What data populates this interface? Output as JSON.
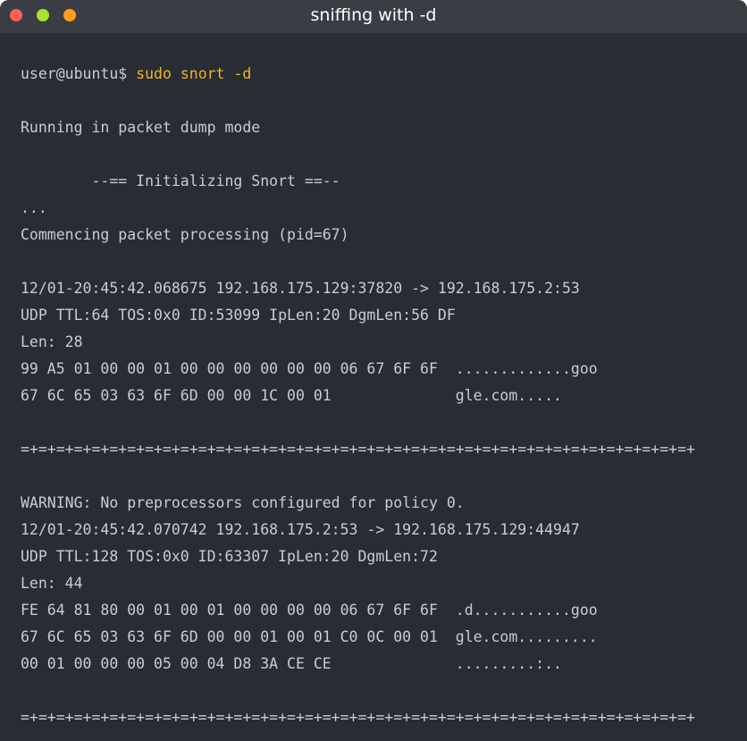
{
  "window": {
    "title": "sniffing with -d",
    "controls": {
      "close_color": "#ff5f57",
      "minimize_color": "#a6e22e",
      "maximize_color": "#ff9f1c"
    }
  },
  "terminal": {
    "prompt": "user@ubuntu$",
    "command": " sudo snort -d",
    "lines": [
      "",
      "Running in packet dump mode",
      "",
      "        --== Initializing Snort ==--",
      "...",
      "Commencing packet processing (pid=67)",
      "",
      "12/01-20:45:42.068675 192.168.175.129:37820 -> 192.168.175.2:53",
      "UDP TTL:64 TOS:0x0 ID:53099 IpLen:20 DgmLen:56 DF",
      "Len: 28",
      "99 A5 01 00 00 01 00 00 00 00 00 00 06 67 6F 6F  .............goo",
      "67 6C 65 03 63 6F 6D 00 00 1C 00 01              gle.com.....",
      "",
      "=+=+=+=+=+=+=+=+=+=+=+=+=+=+=+=+=+=+=+=+=+=+=+=+=+=+=+=+=+=+=+=+=+=+=+=+=+=+",
      "",
      "WARNING: No preprocessors configured for policy 0.",
      "12/01-20:45:42.070742 192.168.175.2:53 -> 192.168.175.129:44947",
      "UDP TTL:128 TOS:0x0 ID:63307 IpLen:20 DgmLen:72",
      "Len: 44",
      "FE 64 81 80 00 01 00 01 00 00 00 00 06 67 6F 6F  .d...........goo",
      "67 6C 65 03 63 6F 6D 00 00 01 00 01 C0 0C 00 01  gle.com.........",
      "00 01 00 00 00 05 00 04 D8 3A CE CE              .........:..",
      "",
      "=+=+=+=+=+=+=+=+=+=+=+=+=+=+=+=+=+=+=+=+=+=+=+=+=+=+=+=+=+=+=+=+=+=+=+=+=+=+"
    ]
  }
}
